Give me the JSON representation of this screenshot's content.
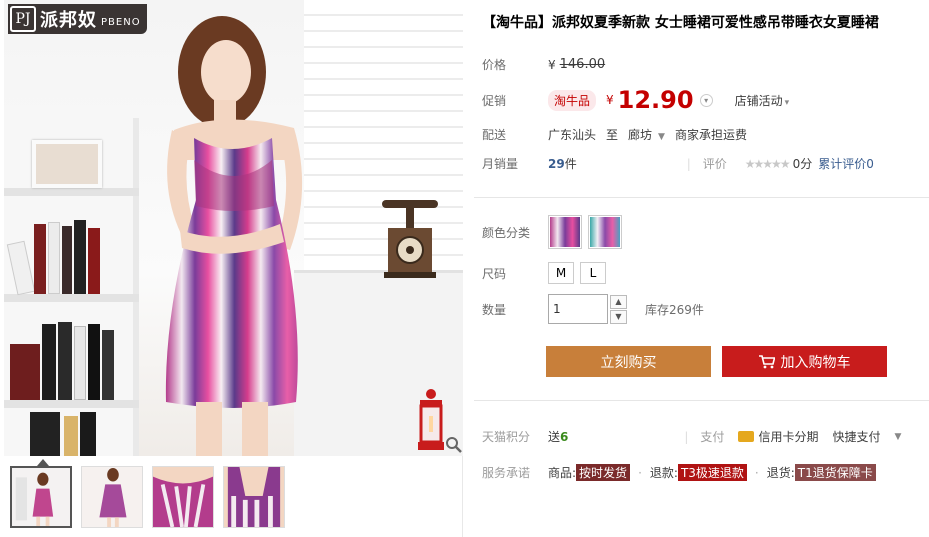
{
  "brand": {
    "logo_cn": "派邦奴",
    "logo_en": "PBENO",
    "logo_mark": "PJ"
  },
  "product": {
    "title": "【淘牛品】派邦奴夏季新款 女士睡裙可爱性感吊带睡衣女夏睡裙"
  },
  "price": {
    "label": "价格",
    "currency": "¥",
    "original": "146.00"
  },
  "promo": {
    "label": "促销",
    "tag": "淘牛品",
    "currency": "¥",
    "price": "12.90",
    "shop_activity": "店铺活动"
  },
  "shipping": {
    "label": "配送",
    "from": "广东汕头",
    "to_word": "至",
    "destination": "廊坊",
    "fee_note": "商家承担运费"
  },
  "sales": {
    "label": "月销量",
    "count": "29",
    "unit": "件",
    "rating_label": "评价",
    "stars": "★★★★★",
    "score": "0分",
    "total_reviews": "累计评价0"
  },
  "options": {
    "color_label": "颜色分类",
    "size_label": "尺码",
    "sizes": [
      "M",
      "L"
    ],
    "qty_label": "数量",
    "qty_value": "1",
    "stock_text": "库存269件"
  },
  "buttons": {
    "buy_now": "立刻购买",
    "add_to_cart": "加入购物车"
  },
  "points": {
    "label": "天猫积分",
    "give": "送",
    "amount": "6",
    "pay_label": "支付",
    "credit_installment": "信用卡分期",
    "quick_pay": "快捷支付"
  },
  "service": {
    "label": "服务承诺",
    "goods_label": "商品:",
    "goods_tag": "按时发货",
    "refund_label": "退款:",
    "refund_tag": "T3极速退款",
    "return_label": "退货:",
    "return_tag": "T1退货保障卡"
  },
  "colors": {
    "accent_red": "#c40000",
    "buy_now_bg": "#c87f3a",
    "cart_bg": "#c81c1c"
  }
}
